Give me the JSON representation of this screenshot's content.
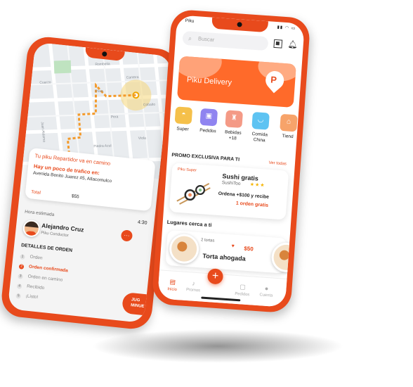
{
  "colors": {
    "brand": "#e84a1c",
    "accent_light": "#ffb08c",
    "star": "#f5b400"
  },
  "tracking": {
    "status_title": "Tu piku Repartidor va en camino",
    "traffic_note": "Hay un poco de trafico en:",
    "address": "Avenida Benito Juarez #5, Atlacomulco",
    "total_label": "Total",
    "total_value": "$55",
    "map_streets": [
      "Rombelia",
      "Cantera",
      "Plata",
      "Cobalto",
      "Pera",
      "Piedra Azul",
      "Juan Aldama",
      "Viola",
      "Cuarzo"
    ]
  },
  "driver": {
    "eta_label": "Hora estimada",
    "eta_value": "4:30",
    "name": "Alejandro Cruz",
    "role": "Piku Conductor"
  },
  "order": {
    "details_title": "DETALLES DE ORDEN",
    "steps": [
      {
        "num": "1",
        "label": "Orden"
      },
      {
        "num": "2",
        "label": "Orden confirmada"
      },
      {
        "num": "3",
        "label": "Orden en camino"
      },
      {
        "num": "4",
        "label": "Recibido"
      },
      {
        "num": "5",
        "label": "¡Listo!"
      }
    ],
    "cta_line1": "JUG",
    "cta_line2": "MINUE"
  },
  "home": {
    "status_app": "Piku",
    "search_placeholder": "Buscar",
    "banner_title": "Piku Delivery",
    "categories": [
      {
        "label": "Super",
        "color": "#f5c04a",
        "icon": "basket-icon"
      },
      {
        "label": "Pedidos",
        "color": "#8f84f0",
        "icon": "box-icon"
      },
      {
        "label": "Bebidas\n+18",
        "color": "#f49a86",
        "icon": "bottle-icon"
      },
      {
        "label": "Comida\nChina",
        "color": "#5ec3f2",
        "icon": "bowl-icon"
      },
      {
        "label": "Tiend",
        "color": "#f7a36a",
        "icon": "store-icon"
      }
    ],
    "promo_header": "PROMO EXCLUSIVA PARA TI",
    "see_all": "Ver todas",
    "promo": {
      "tag": "Piku Super",
      "title": "Sushi gratis",
      "store": "SushiToo",
      "stars": "★★★",
      "line1": "Ordena +$100 y recibe",
      "line2": "1 orden gratis"
    },
    "nearby_header": "Lugares cerca a ti",
    "nearby": {
      "qty": "2 tortas",
      "price": "$50",
      "name": "Torta ahogada"
    },
    "tabs": [
      "Inicio",
      "Promos",
      "Pedidos",
      "Cuenta"
    ],
    "fab": "+"
  }
}
